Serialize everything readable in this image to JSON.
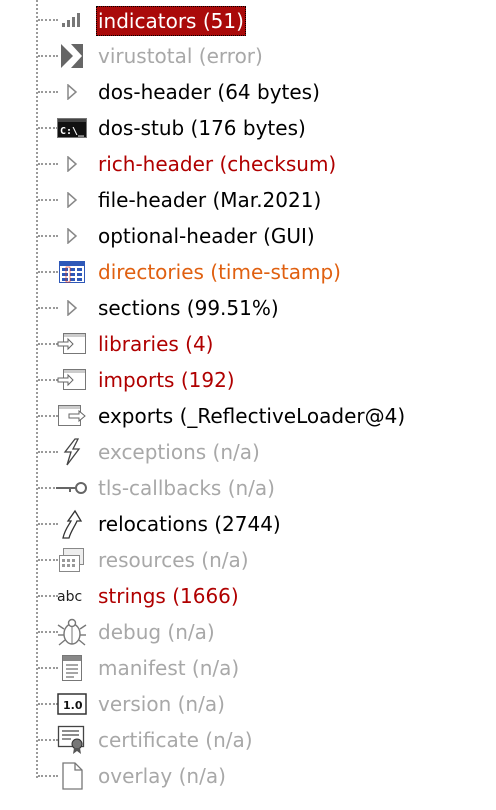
{
  "tree": {
    "items": [
      {
        "label": "indicators (51)",
        "icon": "bar-chart-icon",
        "color": "red",
        "selected": true
      },
      {
        "label": "virustotal (error)",
        "icon": "virustotal-icon",
        "color": "gray"
      },
      {
        "label": "dos-header (64 bytes)",
        "icon": "expand-arrow-icon",
        "color": "black"
      },
      {
        "label": "dos-stub (176 bytes)",
        "icon": "console-icon",
        "color": "black"
      },
      {
        "label": "rich-header (checksum)",
        "icon": "expand-arrow-icon",
        "color": "red"
      },
      {
        "label": "file-header (Mar.2021)",
        "icon": "expand-arrow-icon",
        "color": "black"
      },
      {
        "label": "optional-header (GUI)",
        "icon": "expand-arrow-icon",
        "color": "black"
      },
      {
        "label": "directories (time-stamp)",
        "icon": "directories-grid-icon",
        "color": "orange"
      },
      {
        "label": "sections (99.51%)",
        "icon": "expand-arrow-icon",
        "color": "black"
      },
      {
        "label": "libraries (4)",
        "icon": "import-window-icon",
        "color": "red"
      },
      {
        "label": "imports (192)",
        "icon": "import-window-icon",
        "color": "red"
      },
      {
        "label": "exports (_ReflectiveLoader@4)",
        "icon": "export-window-icon",
        "color": "black"
      },
      {
        "label": "exceptions (n/a)",
        "icon": "lightning-icon",
        "color": "gray"
      },
      {
        "label": "tls-callbacks (n/a)",
        "icon": "key-icon",
        "color": "gray"
      },
      {
        "label": "relocations (2744)",
        "icon": "relocation-arrow-icon",
        "color": "black"
      },
      {
        "label": "resources (n/a)",
        "icon": "resources-icon",
        "color": "gray"
      },
      {
        "label": "strings (1666)",
        "icon": "abc-icon",
        "color": "red"
      },
      {
        "label": "debug (n/a)",
        "icon": "bug-icon",
        "color": "gray"
      },
      {
        "label": "manifest (n/a)",
        "icon": "manifest-icon",
        "color": "gray"
      },
      {
        "label": "version (n/a)",
        "icon": "version-icon",
        "color": "gray"
      },
      {
        "label": "certificate (n/a)",
        "icon": "certificate-icon",
        "color": "gray"
      },
      {
        "label": "overlay (n/a)",
        "icon": "document-icon",
        "color": "gray"
      }
    ],
    "icon_text": {
      "console": "C:\\_",
      "abc": "abc",
      "version": "1.0"
    }
  },
  "colors": {
    "black": "#000000",
    "red": "#b00000",
    "orange": "#e06010",
    "gray": "#a8a8a8",
    "selected_bg": "#aa0a0a"
  }
}
